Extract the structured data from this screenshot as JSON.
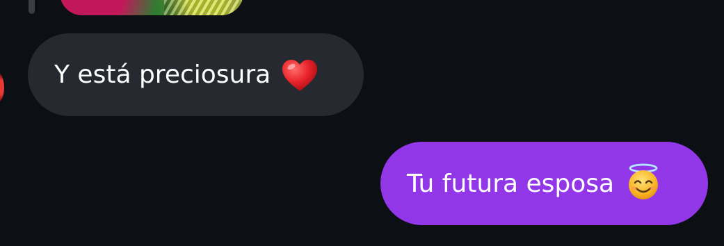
{
  "conversation": {
    "previous_media": {
      "kind": "image"
    },
    "messages": [
      {
        "direction": "incoming",
        "text": "Y está preciosura",
        "emoji": "red-heart",
        "bubble_color": "#262a30"
      },
      {
        "direction": "outgoing",
        "text": "Tu futura esposa",
        "emoji": "smiling-face-with-halo",
        "bubble_color": "#9237e8"
      }
    ]
  },
  "colors": {
    "background": "#0c0f14",
    "incoming_bubble": "#262a30",
    "outgoing_bubble": "#9237e8",
    "text": "#ffffff"
  }
}
